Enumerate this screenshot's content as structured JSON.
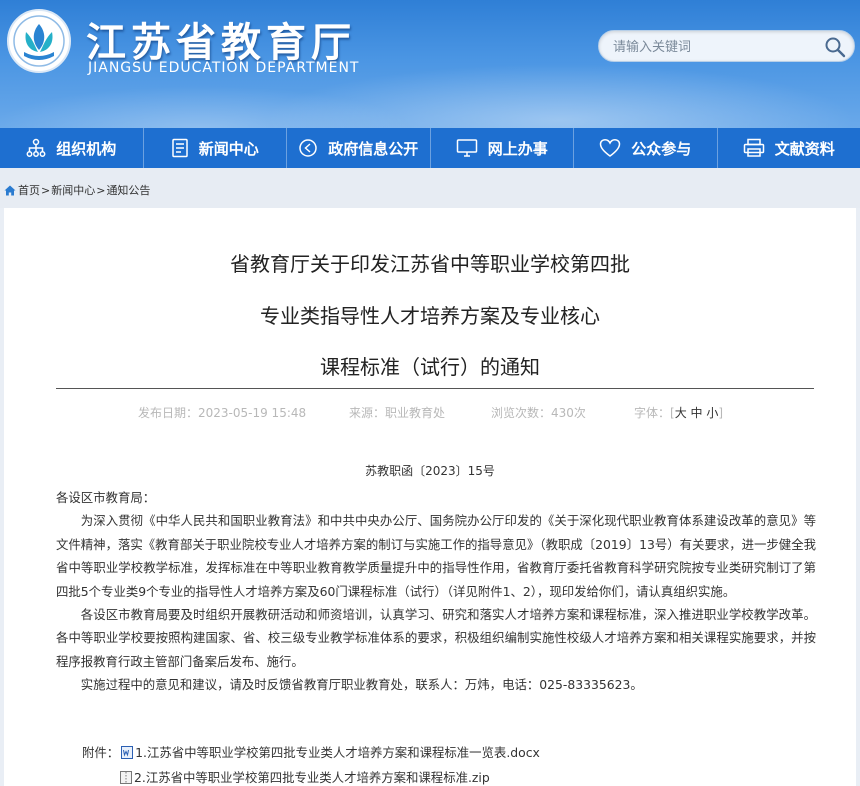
{
  "site": {
    "title_cn": "江苏省教育厅",
    "title_en": "JIANGSU EDUCATION DEPARTMENT",
    "search_placeholder": "请输入关键词"
  },
  "nav": [
    {
      "label": "组织机构",
      "icon": "org-chart-icon"
    },
    {
      "label": "新闻中心",
      "icon": "document-icon"
    },
    {
      "label": "政府信息公开",
      "icon": "info-circle-icon"
    },
    {
      "label": "网上办事",
      "icon": "monitor-icon"
    },
    {
      "label": "公众参与",
      "icon": "heart-icon"
    },
    {
      "label": "文献资料",
      "icon": "printer-icon"
    }
  ],
  "breadcrumb": {
    "home": "首页",
    "items": [
      "新闻中心",
      "通知公告"
    ],
    "separator": ">"
  },
  "article": {
    "title_lines": [
      "省教育厅关于印发江苏省中等职业学校第四批",
      "专业类指导性人才培养方案及专业核心",
      "课程标准（试行）的通知"
    ],
    "meta": {
      "date": "发布日期：2023-05-19 15:48",
      "source": "来源：职业教育处",
      "views": "浏览次数：430次",
      "font_label": "字体：[",
      "size_large": "大",
      "size_medium": "中",
      "size_small": "小",
      "font_close": "]"
    },
    "doc_number": "苏教职函〔2023〕15号",
    "salutation": "各设区市教育局：",
    "paragraphs": [
      "为深入贯彻《中华人民共和国职业教育法》和中共中央办公厅、国务院办公厅印发的《关于深化现代职业教育体系建设改革的意见》等文件精神，落实《教育部关于职业院校专业人才培养方案的制订与实施工作的指导意见》（教职成〔2019〕13号）有关要求，进一步健全我省中等职业学校教学标准，发挥标准在中等职业教育教学质量提升中的指导性作用，省教育厅委托省教育科学研究院按专业类研究制订了第四批5个专业类9个专业的指导性人才培养方案及60门课程标准（试行）（详见附件1、2），现印发给你们，请认真组织实施。",
      "各设区市教育局要及时组织开展教研活动和师资培训，认真学习、研究和落实人才培养方案和课程标准，深入推进职业学校教学改革。各中等职业学校要按照构建国家、省、校三级专业教学标准体系的要求，积极组织编制实施性校级人才培养方案和相关课程实施要求，并按程序报教育行政主管部门备案后发布、施行。",
      "实施过程中的意见和建议，请及时反馈省教育厅职业教育处，联系人：万炜，电话：025-83335623。"
    ],
    "attachments_label": "附件：",
    "attachments": [
      {
        "name": "1.江苏省中等职业学校第四批专业类人才培养方案和课程标准一览表.docx",
        "icon": "docx-file-icon"
      },
      {
        "name": "2.江苏省中等职业学校第四批专业类人才培养方案和课程标准.zip",
        "icon": "zip-file-icon"
      }
    ]
  },
  "colors": {
    "header_blue": "#2f7fd6",
    "nav_blue": "#1e6fd0",
    "breadcrumb_bg": "#e7ecf3"
  }
}
